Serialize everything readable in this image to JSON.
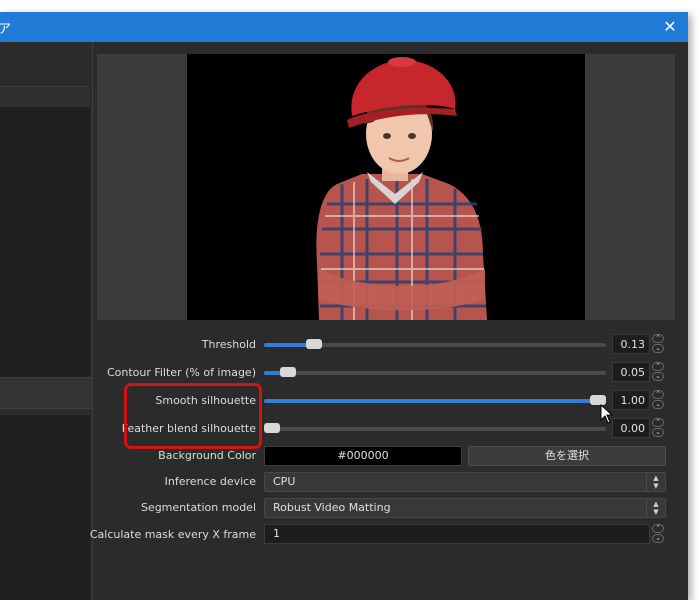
{
  "window": {
    "title": "ア",
    "close_label": "✕"
  },
  "colors": {
    "titlebar": "#1f7bd6",
    "slider_fill": "#2f7fd8",
    "highlight_box": "#d01414"
  },
  "preview": {
    "description_icon": "preview-image"
  },
  "controls": {
    "threshold": {
      "label": "Threshold",
      "value": "0.13",
      "fraction": 0.13
    },
    "contour_filter": {
      "label": "Contour Filter (% of image)",
      "value": "0.05",
      "fraction": 0.05
    },
    "smooth_silhouette": {
      "label": "Smooth silhouette",
      "value": "1.00",
      "fraction": 1.0
    },
    "feather_blend": {
      "label": "Feather blend silhouette",
      "value": "0.00",
      "fraction": 0.0
    },
    "background_color": {
      "label": "Background Color",
      "value": "#000000",
      "button_label": "色を選択"
    },
    "inference_device": {
      "label": "Inference device",
      "value": "CPU"
    },
    "segmentation_model": {
      "label": "Segmentation model",
      "value": "Robust Video Matting"
    },
    "mask_every": {
      "label": "Calculate mask every X frame",
      "value": "1"
    }
  }
}
